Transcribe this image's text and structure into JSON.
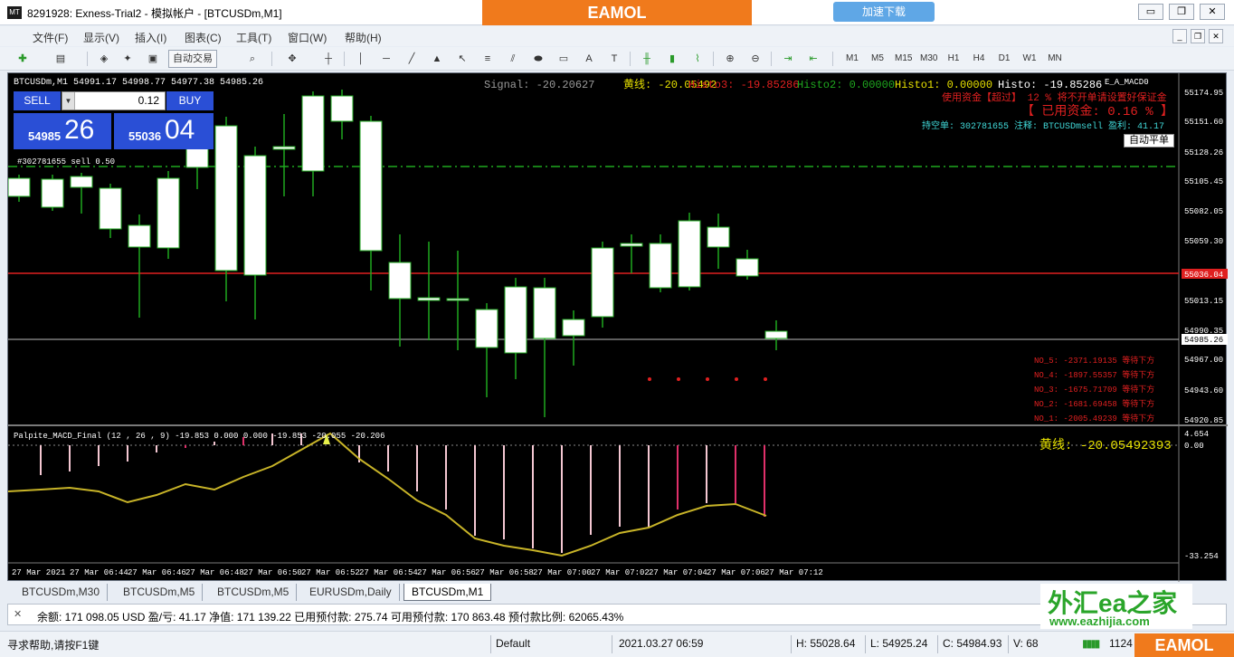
{
  "window": {
    "app_icon": "MT",
    "title": "8291928: Exness-Trial2 - 模拟帐户 - [BTCUSDm,M1]",
    "ad_top_orange": "EAMOL",
    "ad_top_blue": "加速下载",
    "controls": [
      "▭",
      "❐",
      "✕"
    ]
  },
  "menu": {
    "items": [
      "文件(F)",
      "显示(V)",
      "插入(I)",
      "图表(C)",
      "工具(T)",
      "窗口(W)",
      "帮助(H)"
    ],
    "mdi_controls": [
      "_",
      "❐",
      "✕"
    ]
  },
  "toolbar": {
    "auto_trade": "自动交易",
    "text_tool": "A",
    "label_tool": "T",
    "timeframes": [
      "M1",
      "M5",
      "M15",
      "M30",
      "H1",
      "H4",
      "D1",
      "W1",
      "MN"
    ]
  },
  "chart": {
    "symbol_header": "BTCUSDm,M1  54991.17 54998.77 54977.38 54985.26",
    "ea_name": "E_A_MACD0",
    "signal_text": "Signal: -20.20627",
    "yellow_line_text": "黄线: -20.05492",
    "histo3_text": "Histo3: -19.85286",
    "histo2_text": "Histo2: 0.00000",
    "histo1_text": "Histo1: 0.00000",
    "histo_text": "Histo: -19.85286",
    "funds_warning": "使用资金【超过】 12 % 将不开单请设置好保证金",
    "used_funds": "【 已用资金: 0.16 % 】",
    "position_info": "持空单: 302781655 注释: BTCUSDmsell 盈利: 41.17",
    "auto_close_button": "自动平单",
    "order_label": "#302781655 sell 0.50",
    "price_axis": [
      "55174.95",
      "55151.60",
      "55128.26",
      "55105.45",
      "55082.05",
      "55059.30",
      "55036.04",
      "55013.15",
      "54990.35",
      "54985.26",
      "54967.00",
      "54943.60",
      "54920.85"
    ],
    "current_price": "54985.26",
    "red_line_price": "55036.04",
    "levels": [
      {
        "text": "NO_5: -2371.19135  等待下方"
      },
      {
        "text": "NO_4: -1897.55357  等待下方"
      },
      {
        "text": "NO_3: -1675.71709  等待下方"
      },
      {
        "text": "NO_2: -1681.69458  等待下方"
      },
      {
        "text": "NO_1: -2005.49239  等待下方"
      }
    ],
    "macd_header": "Palpite_MACD_Final  (12 , 26 , 9) -19.853 0.000 0.000 -19.853 -20.055 -20.206",
    "macd_yellow_label": "黄线: -20.05492393",
    "macd_axis": [
      "4.654",
      "0.00",
      "-33.254"
    ],
    "time_axis": [
      "27 Mar 2021",
      "27 Mar 06:44",
      "27 Mar 06:46",
      "27 Mar 06:48",
      "27 Mar 06:50",
      "27 Mar 06:52",
      "27 Mar 06:54",
      "27 Mar 06:56",
      "27 Mar 06:58",
      "27 Mar 07:00",
      "27 Mar 07:02",
      "27 Mar 07:04",
      "27 Mar 07:06",
      "27 Mar 07:12"
    ],
    "colors": {
      "bull_body": "#ffffff",
      "wick": "#1fa81f",
      "red_line": "#e02020",
      "dash_green": "#1fa81f",
      "macd_line": "#c8b428",
      "hist_pink": "#f4c7d2",
      "hist_red": "#e0306a"
    }
  },
  "trade_panel": {
    "sell_label": "SELL",
    "buy_label": "BUY",
    "lot": "0.12",
    "sell_small": "54985",
    "sell_big": "26",
    "buy_small": "55036",
    "buy_big": "04"
  },
  "chart_tabs": [
    "BTCUSDm,M30",
    "BTCUSDm,M5",
    "BTCUSDm,M5",
    "EURUSDm,Daily",
    "BTCUSDm,M1"
  ],
  "account": {
    "text": "余额: 171 098.05 USD  盈/亏: 41.17  净值: 171 139.22  已用预付款: 275.74  可用预付款: 170 863.48  预付款比例: 62065.43%"
  },
  "ad_right": {
    "brand": "外汇ea之家",
    "url": "www.eazhijia.com"
  },
  "status": {
    "help": "寻求帮助,请按F1键",
    "profile": "Default",
    "datetime": "2021.03.27 06:59",
    "high": "H: 55028.64",
    "low": "L: 54925.24",
    "close": "C: 54984.93",
    "volume": "V: 68",
    "traffic": "1124",
    "ad": "EAMOL"
  }
}
